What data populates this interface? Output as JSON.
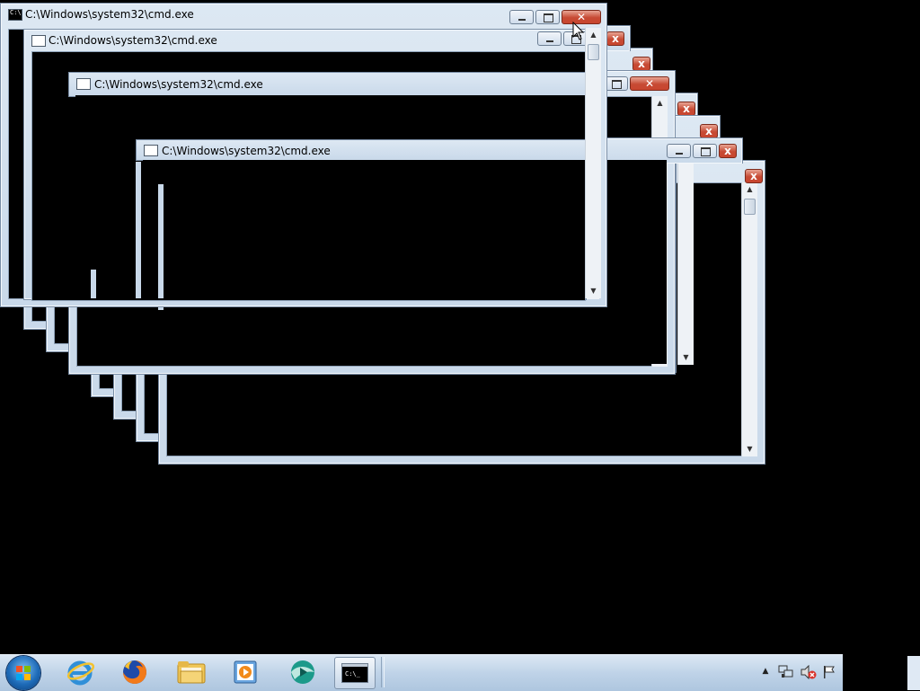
{
  "windows": [
    {
      "title": "C:\\Windows\\system32\\cmd.exe"
    },
    {
      "title": "C:\\Windows\\system32\\cmd.exe"
    },
    {
      "title": "C:\\Windows\\system32\\cmd.exe"
    },
    {
      "title": "C:\\Windows\\system32\\cmd.exe"
    }
  ],
  "taskbar": {
    "items": [
      {
        "name": "Internet Explorer"
      },
      {
        "name": "Firefox"
      },
      {
        "name": "Windows Explorer"
      },
      {
        "name": "Windows Media Player"
      },
      {
        "name": "Media app"
      },
      {
        "name": "Command Prompt",
        "active": true
      }
    ],
    "tray": {
      "icons": [
        "show-hidden-icons-icon",
        "network-icon",
        "volume-muted-icon",
        "action-center-flag-icon"
      ]
    }
  },
  "colors": {
    "desktop": "#000000",
    "window_frame": "#c9d9ea",
    "close_button": "#c74a34",
    "taskbar": "#bfd3e8"
  }
}
